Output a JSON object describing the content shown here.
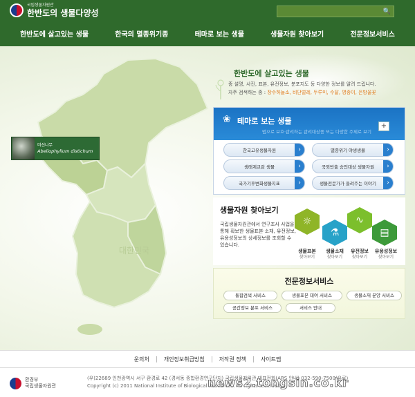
{
  "header": {
    "logo_sub": "국립생물자원관",
    "logo_main": "한반도의 생물다양성",
    "search_placeholder": ""
  },
  "nav": [
    "한반도에 살고있는 생물",
    "한국의 멸종위기종",
    "테마로 보는 생물",
    "생물자원 찾아보기",
    "전문정보서비스"
  ],
  "intro": {
    "title": "한반도에 살고있는 생물",
    "desc": "종 설명, 사진, 표본, 유전정보, 분포지도 등 다양한 정보를 알려 드립니다.",
    "freq_label": "자주 검색하는 종 : ",
    "freq_links": "장수하늘소, 비단벌레, 두루미, 수달, 명종이, 은방울꽃"
  },
  "specimen": {
    "name_kr": "미선나무",
    "name_la": "Abeliophyllum distichum"
  },
  "theme": {
    "title": "테마로 보는 생물",
    "subtitle": "법으로 보호·관리하는 관리대상종 또는 다양한 주제로 보기",
    "more": "+",
    "items": [
      "한국고유생물자원",
      "멸종위기 야생생물",
      "생태계교란 생물",
      "국외반출 승인대상 생물자원",
      "국가기후변화생물지표",
      "생물전문가가 들려주는 이야기"
    ]
  },
  "resource": {
    "title": "생물자원 찾아보기",
    "desc": "국립생물자원관에서 연구조사 사업을 통해 확보한 생물표본·소재, 유전정보, 유용성정보의 상세정보를 조회할 수 있습니다.",
    "items": [
      {
        "label": "생물표본",
        "sub": "찾아보기",
        "color": "#8fb528",
        "icon": "bug-icon"
      },
      {
        "label": "생물소재",
        "sub": "찾아보기",
        "color": "#27a2c8",
        "icon": "flask-icon"
      },
      {
        "label": "유전정보",
        "sub": "찾아보기",
        "color": "#7cbf2c",
        "icon": "dna-icon"
      },
      {
        "label": "유용성정보",
        "sub": "찾아보기",
        "color": "#3d9a3a",
        "icon": "chart-icon"
      }
    ]
  },
  "expert": {
    "title": "전문정보서비스",
    "items": [
      "통합검색 서비스",
      "생물표본 대여 서비스",
      "생물소재 분양 서비스",
      "공간정보 분포 서비스",
      "서비스 안내"
    ]
  },
  "footer": {
    "links": [
      "운의처",
      "개인정보취급방침",
      "저작권 정책",
      "사이트맵"
    ],
    "org_line1": "환경부",
    "org_line2": "국립생물자원관",
    "address": "(우)22689 인천광역시 서구 환경로 42 (경서동 종합환경연구단지) 국립생물자원관 대표전화(ARS 안내) 032-590-7500(유료)",
    "copyright": "Copyright (c) 2011 National Institute of Biological Resources. All rights reserved."
  },
  "watermark": "news2.tongsin.co.kr"
}
